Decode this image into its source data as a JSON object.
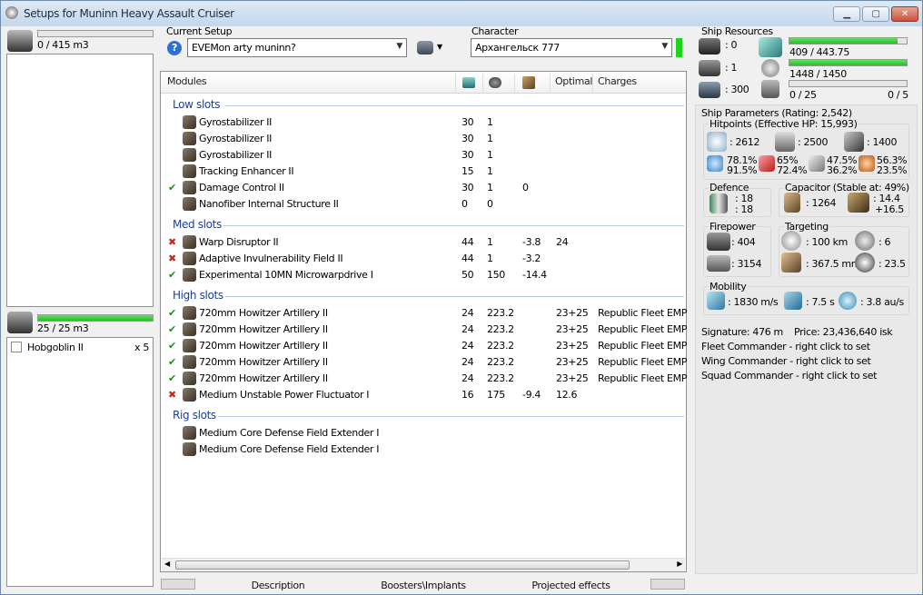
{
  "window": {
    "title": "Setups for Muninn Heavy Assault Cruiser"
  },
  "cargo": {
    "capacity": "0 / 415 m3",
    "fill": 0
  },
  "drones": {
    "capacity": "25 / 25 m3",
    "fill": 1,
    "items": [
      {
        "name": "Hobgoblin II",
        "qty": "x 5"
      }
    ]
  },
  "setup": {
    "label": "Current Setup",
    "value": "EVEMon arty muninn?"
  },
  "character": {
    "label": "Character",
    "value": "Архангельск 777"
  },
  "modules": {
    "columns": {
      "name": "Modules",
      "optimal": "Optimal",
      "charges": "Charges"
    },
    "sections": [
      {
        "title": "Low slots",
        "rows": [
          {
            "name": "Gyrostabilizer II",
            "status": "",
            "cpu": "30",
            "pg": "1",
            "cap": "",
            "optimal": "",
            "charge": ""
          },
          {
            "name": "Gyrostabilizer II",
            "status": "",
            "cpu": "30",
            "pg": "1",
            "cap": "",
            "optimal": "",
            "charge": ""
          },
          {
            "name": "Gyrostabilizer II",
            "status": "",
            "cpu": "30",
            "pg": "1",
            "cap": "",
            "optimal": "",
            "charge": ""
          },
          {
            "name": "Tracking Enhancer II",
            "status": "",
            "cpu": "15",
            "pg": "1",
            "cap": "",
            "optimal": "",
            "charge": ""
          },
          {
            "name": "Damage Control II",
            "status": "ok",
            "cpu": "30",
            "pg": "1",
            "cap": "0",
            "optimal": "",
            "charge": ""
          },
          {
            "name": "Nanofiber Internal Structure II",
            "status": "",
            "cpu": "0",
            "pg": "0",
            "cap": "",
            "optimal": "",
            "charge": ""
          }
        ]
      },
      {
        "title": "Med slots",
        "rows": [
          {
            "name": "Warp Disruptor II",
            "status": "off",
            "cpu": "44",
            "pg": "1",
            "cap": "-3.8",
            "optimal": "24",
            "charge": ""
          },
          {
            "name": "Adaptive Invulnerability Field II",
            "status": "off",
            "cpu": "44",
            "pg": "1",
            "cap": "-3.2",
            "optimal": "",
            "charge": ""
          },
          {
            "name": "Experimental 10MN Microwarpdrive I",
            "status": "ok",
            "cpu": "50",
            "pg": "150",
            "cap": "-14.4",
            "optimal": "",
            "charge": ""
          }
        ]
      },
      {
        "title": "High slots",
        "rows": [
          {
            "name": "720mm Howitzer Artillery II",
            "status": "ok",
            "cpu": "24",
            "pg": "223.2",
            "cap": "",
            "optimal": "23+25",
            "charge": "Republic Fleet EMP"
          },
          {
            "name": "720mm Howitzer Artillery II",
            "status": "ok",
            "cpu": "24",
            "pg": "223.2",
            "cap": "",
            "optimal": "23+25",
            "charge": "Republic Fleet EMP"
          },
          {
            "name": "720mm Howitzer Artillery II",
            "status": "ok",
            "cpu": "24",
            "pg": "223.2",
            "cap": "",
            "optimal": "23+25",
            "charge": "Republic Fleet EMP"
          },
          {
            "name": "720mm Howitzer Artillery II",
            "status": "ok",
            "cpu": "24",
            "pg": "223.2",
            "cap": "",
            "optimal": "23+25",
            "charge": "Republic Fleet EMP"
          },
          {
            "name": "720mm Howitzer Artillery II",
            "status": "ok",
            "cpu": "24",
            "pg": "223.2",
            "cap": "",
            "optimal": "23+25",
            "charge": "Republic Fleet EMP"
          },
          {
            "name": "Medium Unstable Power Fluctuator I",
            "status": "off",
            "cpu": "16",
            "pg": "175",
            "cap": "-9.4",
            "optimal": "12.6",
            "charge": ""
          }
        ]
      },
      {
        "title": "Rig slots",
        "rows": [
          {
            "name": "Medium Core Defense Field Extender I",
            "status": "",
            "cpu": "",
            "pg": "",
            "cap": "",
            "optimal": "",
            "charge": ""
          },
          {
            "name": "Medium Core Defense Field Extender I",
            "status": "",
            "cpu": "",
            "pg": "",
            "cap": "",
            "optimal": "",
            "charge": ""
          }
        ]
      }
    ]
  },
  "tabs": [
    "Description",
    "Boosters\\Implants",
    "Projected effects"
  ],
  "resources": {
    "title": "Ship Resources",
    "turret": ": 0",
    "launcher": ": 1",
    "calibration": ": 300",
    "cpu": "409 / 443.75",
    "cpu_fill": 0.922,
    "power": "1448 / 1450",
    "power_fill": 0.9986,
    "drone_bw": "0 / 25",
    "drone_bw_fill": 0,
    "drones_active": "0 / 5"
  },
  "params": {
    "title": "Ship Parameters (Rating: 2,542)",
    "hitpoints": {
      "title": "Hitpoints (Effective HP: 15,993)",
      "shield": ": 2612",
      "armor": ": 2500",
      "structure": ": 1400",
      "r1a": "78.1%",
      "r1b": "91.5%",
      "r2a": "65%",
      "r2b": "72.4%",
      "r3a": "47.5%",
      "r3b": "36.2%",
      "r4a": "56.3%",
      "r4b": "23.5%"
    },
    "defence": {
      "title": "Defence",
      "v1": ": 18",
      "v2": ": 18"
    },
    "capacitor": {
      "title": "Capacitor (Stable at: 49%)",
      "cap": ": 1264",
      "r1": ": 14.4",
      "r2": "+16.5"
    },
    "firepower": {
      "title": "Firepower",
      "dps": ": 404",
      "volley": ": 3154"
    },
    "targeting": {
      "title": "Targeting",
      "range": ": 100 km",
      "targets": ": 6",
      "scan": ": 367.5 mm",
      "sig": ": 23.5"
    },
    "mobility": {
      "title": "Mobility",
      "speed": ": 1830 m/s",
      "align": ": 7.5 s",
      "warp": ": 3.8 au/s"
    },
    "signature": "Signature: 476 m",
    "price": "Price: 23,436,640 isk",
    "fleet": "Fleet Commander - right click to set",
    "wing": "Wing Commander - right click to set",
    "squad": "Squad Commander - right click to set"
  }
}
